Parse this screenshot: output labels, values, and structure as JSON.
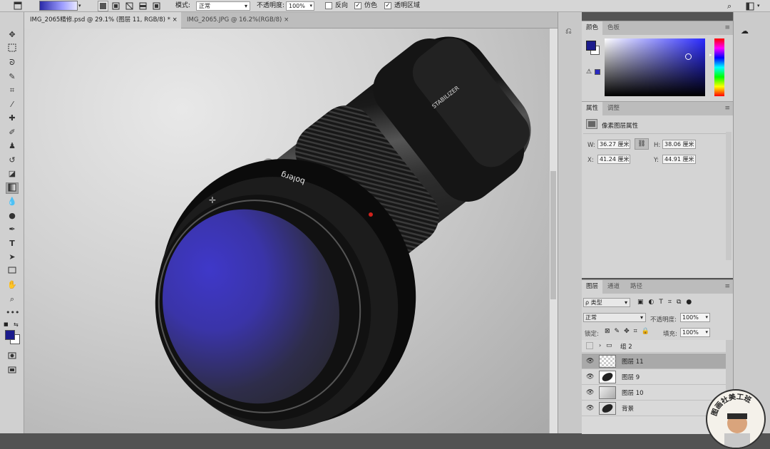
{
  "options_bar": {
    "mode_label": "模式:",
    "mode_value": "正常",
    "opacity_label": "不透明度:",
    "opacity_value": "100%",
    "reverse_label": "反向",
    "dither_label": "仿色",
    "transparency_label": "透明区域"
  },
  "tabs": [
    {
      "label": "IMG_2065精修.psd @ 29.1% (图层 11, RGB/8) *",
      "close": "×"
    },
    {
      "label": "IMG_2065.JPG @ 16.2%(RGB/8)",
      "close": "×"
    }
  ],
  "canvas": {
    "lens_ring_text": "bolerg",
    "lens_body_text": "STABILIZER"
  },
  "color_panel": {
    "tabs": [
      "颜色",
      "色板"
    ],
    "foreground": "#1b1b8c",
    "background": "#ffffff"
  },
  "properties_panel": {
    "tabs": [
      "属性",
      "调整"
    ],
    "title": "像素图层属性",
    "w_label": "W:",
    "w_value": "36.27 厘米",
    "h_label": "H:",
    "h_value": "38.06 厘米",
    "x_label": "X:",
    "x_value": "41.24 厘米",
    "y_label": "Y:",
    "y_value": "44.91 厘米"
  },
  "layers_panel": {
    "tabs": [
      "图层",
      "通道",
      "路径"
    ],
    "filter": "ρ 类型",
    "blend_mode": "正常",
    "opacity_label": "不透明度:",
    "opacity_value": "100%",
    "lock_label": "锁定:",
    "fill_label": "填充:",
    "fill_value": "100%",
    "layers": [
      {
        "name": "组 2",
        "type": "group",
        "visible": false,
        "selected": false
      },
      {
        "name": "图层 11",
        "type": "layer",
        "visible": true,
        "selected": true
      },
      {
        "name": "图层 9",
        "type": "layer",
        "visible": true,
        "selected": false
      },
      {
        "name": "图层 10",
        "type": "layer",
        "visible": true,
        "selected": false
      },
      {
        "name": "背景",
        "type": "layer",
        "visible": true,
        "selected": false
      }
    ]
  },
  "watermark": {
    "text": "图画社美工班"
  },
  "colors": {
    "ui_panel": "#d4d4d4",
    "selected_layer": "#a9a9a9",
    "lens_tint": "#3a34b8"
  }
}
